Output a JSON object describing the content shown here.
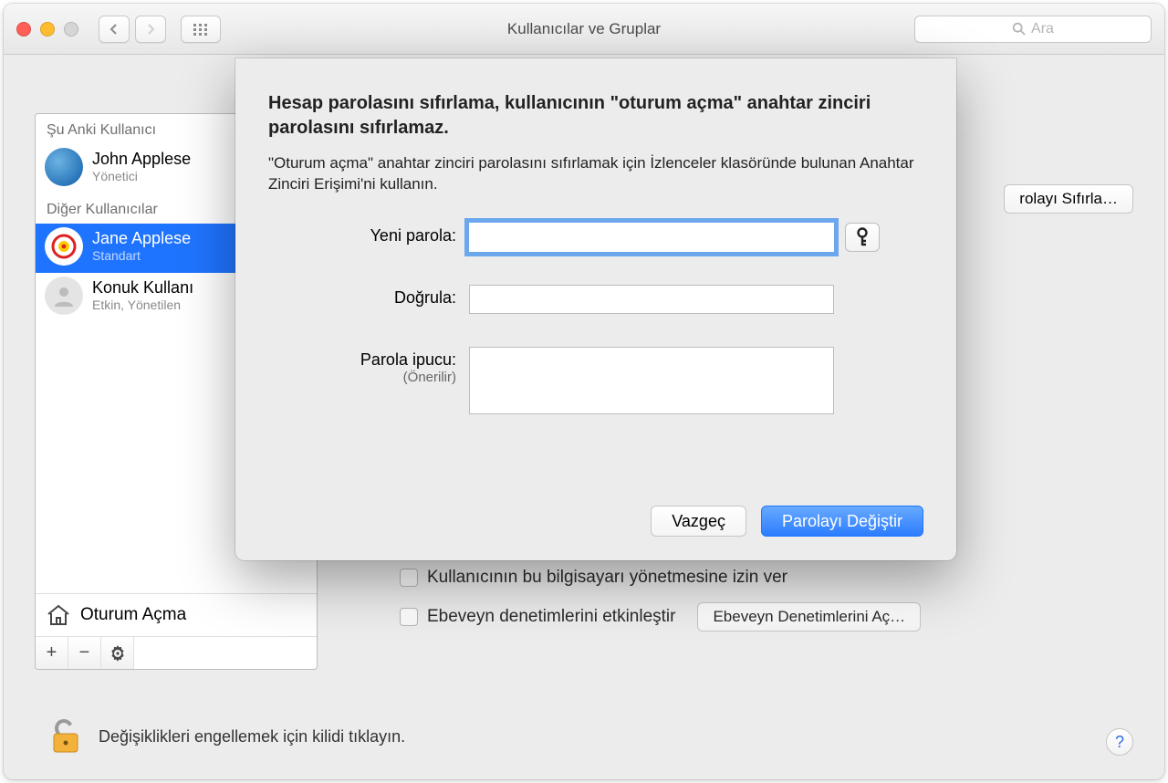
{
  "window": {
    "title": "Kullanıcılar ve Gruplar",
    "search_placeholder": "Ara"
  },
  "sidebar": {
    "current_label": "Şu Anki Kullanıcı",
    "other_label": "Diğer Kullanıcılar",
    "current": {
      "name": "John Applese",
      "role": "Yönetici"
    },
    "others": [
      {
        "name": "Jane Applese",
        "role": "Standart",
        "selected": true
      },
      {
        "name": "Konuk Kullanı",
        "role": "Etkin, Yönetilen"
      }
    ],
    "login_options": "Oturum Açma"
  },
  "main": {
    "reset_button": "rolayı Sıfırla…",
    "checks": {
      "allow_admin": "Kullanıcının bu bilgisayarı yönetmesine izin ver",
      "parental": "Ebeveyn denetimlerini etkinleştir",
      "parental_btn": "Ebeveyn Denetimlerini Aç…"
    }
  },
  "sheet": {
    "heading": "Hesap parolasını sıfırlama, kullanıcının \"oturum açma\" anahtar zinciri parolasını sıfırlamaz.",
    "subtext": "\"Oturum açma\" anahtar zinciri parolasını sıfırlamak için İzlenceler klasöründe bulunan Anahtar Zinciri Erişimi'ni kullanın.",
    "new_password_label": "Yeni parola:",
    "verify_label": "Doğrula:",
    "hint_label": "Parola ipucu:",
    "hint_sub": "(Önerilir)",
    "cancel": "Vazgeç",
    "change": "Parolayı Değiştir"
  },
  "lock_text": "Değişiklikleri engellemek için kilidi tıklayın."
}
